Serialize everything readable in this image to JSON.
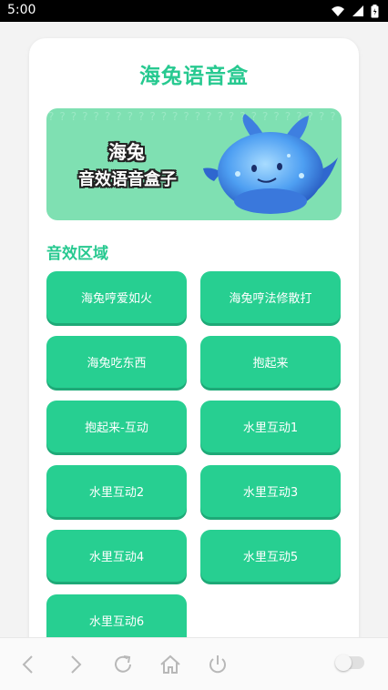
{
  "status_bar": {
    "time": "5:00"
  },
  "app": {
    "title": "海兔语音盒"
  },
  "banner": {
    "line1": "海兔",
    "line2": "音效语音盒子",
    "pattern_char": "?"
  },
  "section": {
    "title": "音效区域"
  },
  "sounds": [
    "海兔哼爱如火",
    "海兔哼法修散打",
    "海兔吃东西",
    "抱起来",
    "抱起来-互动",
    "水里互动1",
    "水里互动2",
    "水里互动3",
    "水里互动4",
    "水里互动5",
    "水里互动6"
  ],
  "colors": {
    "accent": "#27c990",
    "button": "#27cf91",
    "banner_bg": "#7fe0b2"
  },
  "bottom_nav": {
    "icons": [
      "back-icon",
      "forward-icon",
      "refresh-icon",
      "home-icon",
      "power-icon"
    ],
    "toggle_on": false
  }
}
